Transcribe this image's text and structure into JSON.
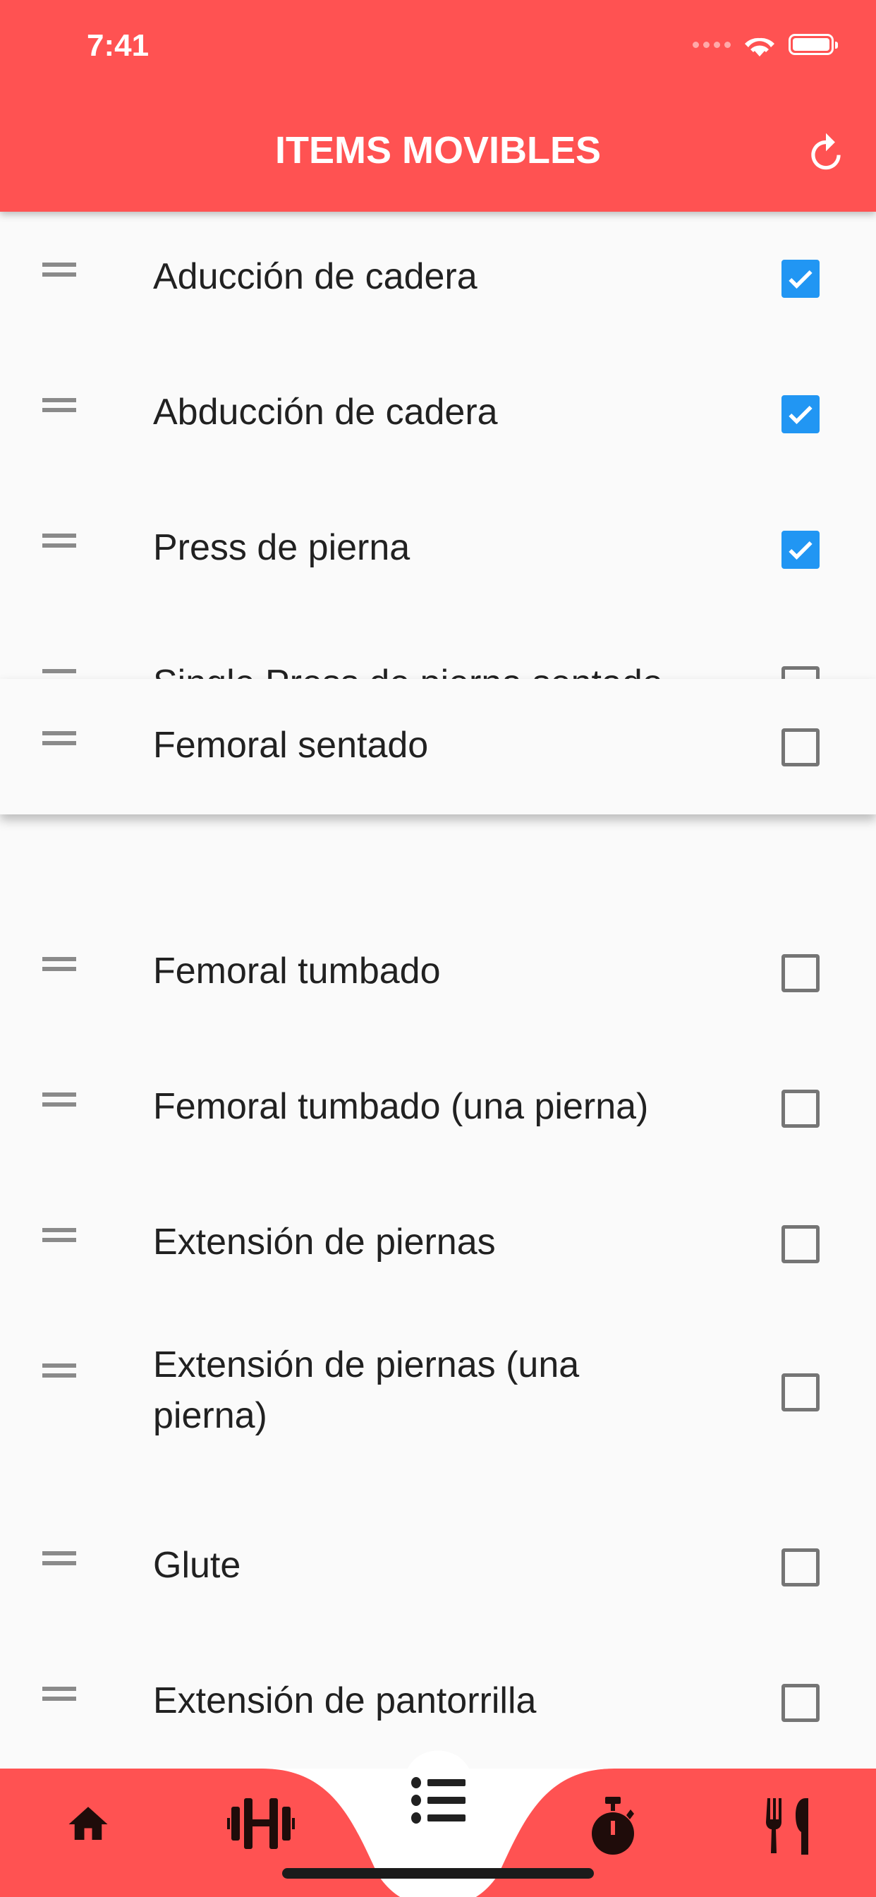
{
  "status_bar": {
    "time": "7:41"
  },
  "header": {
    "title": "ITEMS MOVIBLES",
    "reset_icon": "refresh-icon"
  },
  "colors": {
    "primary": "#ff5252",
    "checkbox_checked": "#2196f3",
    "icon_dark": "#1f0c0a"
  },
  "items": [
    {
      "label": "Aducción de cadera",
      "checked": true
    },
    {
      "label": "Abducción de cadera",
      "checked": true
    },
    {
      "label": "Press de pierna",
      "checked": true
    },
    {
      "label": "Single Press de pierna sentado",
      "checked": false
    },
    {
      "label": "Femoral tumbado",
      "checked": false
    },
    {
      "label": "Femoral tumbado (una pierna)",
      "checked": false
    },
    {
      "label": "Extensión de piernas",
      "checked": false
    },
    {
      "label": "Extensión de piernas (una pierna)",
      "checked": false
    },
    {
      "label": "Glute",
      "checked": false
    },
    {
      "label": "Extensión de pantorrilla",
      "checked": false
    }
  ],
  "dragged_item": {
    "label": "Femoral sentado",
    "checked": false
  },
  "bottom_nav": {
    "items": [
      "home-icon",
      "dumbbell-icon",
      "list-icon",
      "stopwatch-icon",
      "restaurant-icon"
    ],
    "active": "list-icon"
  }
}
